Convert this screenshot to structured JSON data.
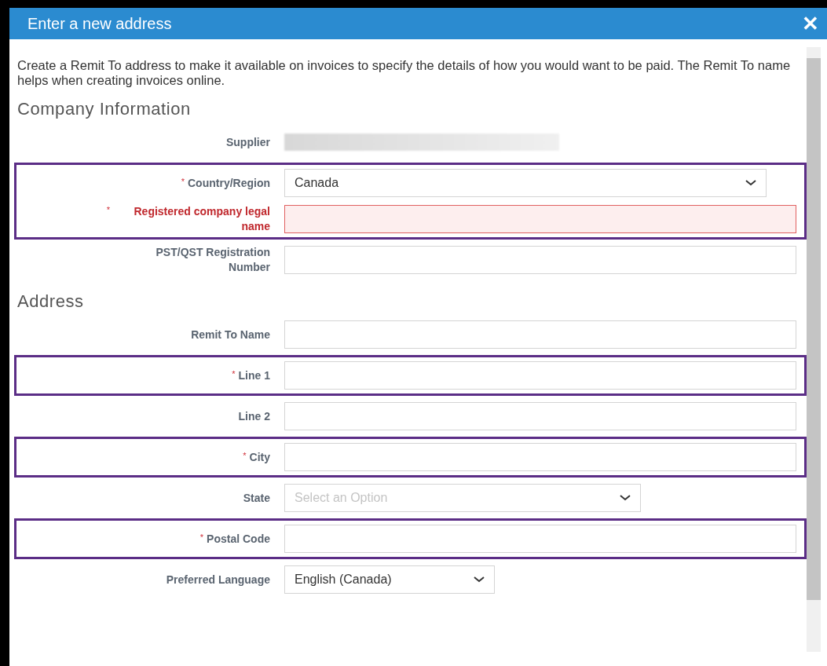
{
  "dialog": {
    "title": "Enter a new address",
    "close": "✕",
    "intro": "Create a Remit To address to make it available on invoices to specify the details of how you would want to be paid. The Remit To name helps when creating invoices online.",
    "sections": [
      {
        "title": "Company Information",
        "groups": [
          {
            "highlighted": false,
            "fields": [
              {
                "label": "Supplier",
                "kind": "redacted",
                "error": false
              }
            ]
          },
          {
            "highlighted": true,
            "fields": [
              {
                "label": "Country/Region",
                "kind": "select",
                "value": "Canada",
                "required_mark": "*",
                "error": false
              },
              {
                "label": "Registered company legal name",
                "kind": "text",
                "required_mark": "*",
                "error": true
              }
            ]
          },
          {
            "highlighted": false,
            "fields": [
              {
                "label": "PST/QST Registration Number",
                "kind": "text",
                "error": false
              }
            ]
          }
        ]
      },
      {
        "title": "Address",
        "groups": [
          {
            "highlighted": false,
            "fields": [
              {
                "label": "Remit To Name",
                "kind": "text",
                "error": false
              }
            ]
          },
          {
            "highlighted": true,
            "fields": [
              {
                "label": "Line 1",
                "kind": "text",
                "required_mark": "*",
                "error": false
              }
            ]
          },
          {
            "highlighted": false,
            "fields": [
              {
                "label": "Line 2",
                "kind": "text",
                "error": false
              }
            ]
          },
          {
            "highlighted": true,
            "fields": [
              {
                "label": "City",
                "kind": "text",
                "required_mark": "*",
                "error": false
              }
            ]
          },
          {
            "highlighted": false,
            "fields": [
              {
                "label": "State",
                "kind": "select-medium",
                "placeholder": "Select an Option",
                "error": false
              }
            ]
          },
          {
            "highlighted": true,
            "fields": [
              {
                "label": "Postal Code",
                "kind": "text",
                "required_mark": "*",
                "error": false
              }
            ]
          },
          {
            "highlighted": false,
            "fields": [
              {
                "label": "Preferred Language",
                "kind": "select-small",
                "value": "English (Canada)",
                "error": false
              }
            ]
          }
        ]
      }
    ]
  }
}
